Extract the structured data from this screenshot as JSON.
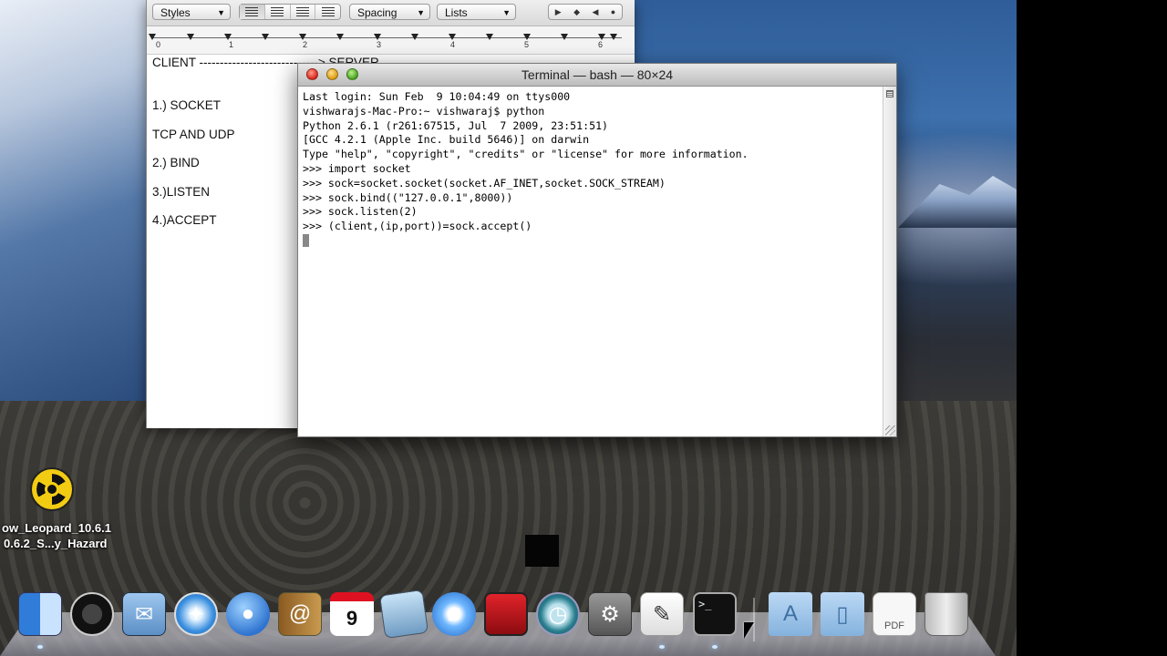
{
  "textedit": {
    "toolbar": {
      "styles_label": "Styles",
      "spacing_label": "Spacing",
      "lists_label": "Lists"
    },
    "ruler": {
      "numbers": [
        "0",
        "1",
        "2",
        "3",
        "4",
        "5",
        "6"
      ]
    },
    "document": {
      "line1": "CLIENT -----------------------------> SERVER",
      "line2": "1.) SOCKET",
      "line3": "TCP AND UDP",
      "line4": "2.) BIND",
      "line5": "3.)LISTEN",
      "line6": "4.)ACCEPT"
    }
  },
  "terminal": {
    "title": "Terminal — bash — 80×24",
    "lines": [
      "Last login: Sun Feb  9 10:04:49 on ttys000",
      "vishwarajs-Mac-Pro:~ vishwaraj$ python",
      "Python 2.6.1 (r261:67515, Jul  7 2009, 23:51:51)",
      "[GCC 4.2.1 (Apple Inc. build 5646)] on darwin",
      "Type \"help\", \"copyright\", \"credits\" or \"license\" for more information.",
      ">>> import socket",
      ">>> sock=socket.socket(socket.AF_INET,socket.SOCK_STREAM)",
      ">>> sock.bind((\"127.0.0.1\",8000))",
      ">>> sock.listen(2)",
      ">>> (client,(ip,port))=sock.accept()"
    ]
  },
  "desktop_icon": {
    "icon": "radiation-hazard-icon",
    "label_line1": "ow_Leopard_10.6.1",
    "label_line2": "0.6.2_S...y_Hazard"
  },
  "dock": {
    "ical_day": "9",
    "terminal_prompt": ">_",
    "items": [
      "finder-icon",
      "dashboard-icon",
      "mail-icon",
      "safari-icon",
      "ichat-icon",
      "address-book-icon",
      "ical-icon",
      "iphoto-icon",
      "itunes-icon",
      "front-row-icon",
      "time-machine-icon",
      "system-preferences-icon",
      "textedit-icon",
      "terminal-icon",
      "applications-folder-icon",
      "documents-folder-icon",
      "pdf-document-icon",
      "trash-icon"
    ]
  }
}
